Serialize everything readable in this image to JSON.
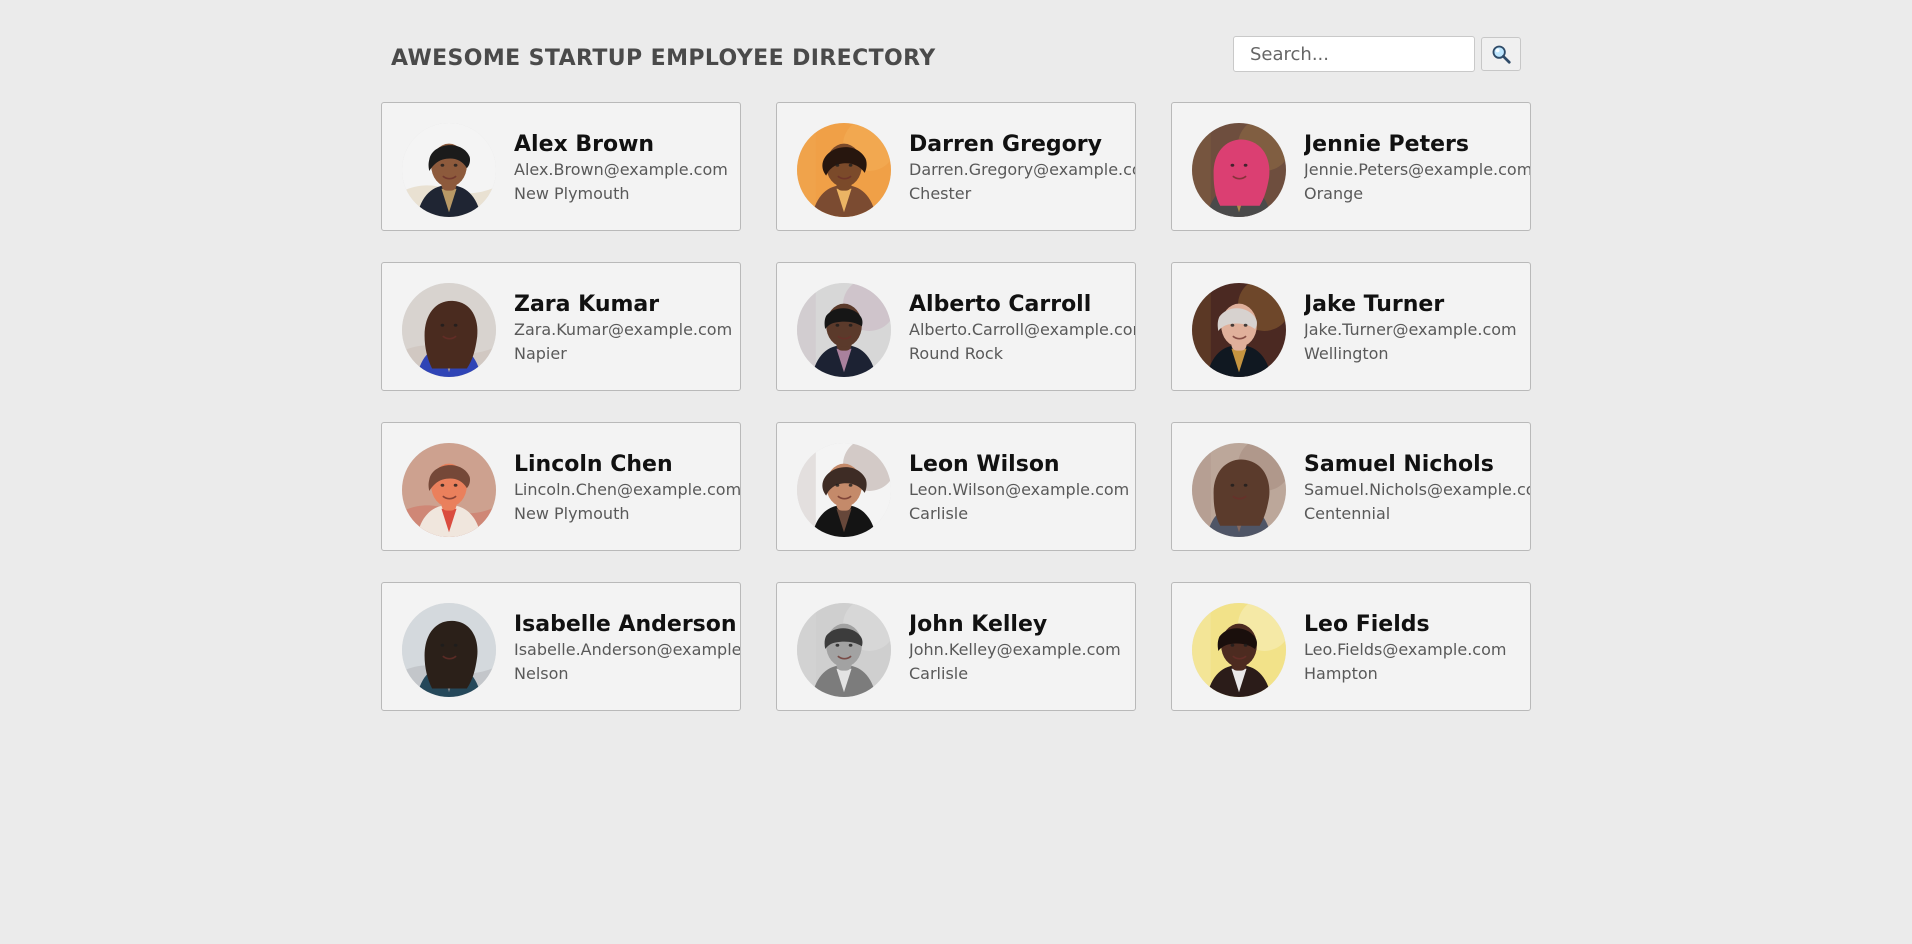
{
  "header": {
    "title": "AWESOME STARTUP EMPLOYEE DIRECTORY",
    "search": {
      "placeholder": "Search...",
      "value": "",
      "button_icon": "magnifier-icon"
    }
  },
  "employees": [
    {
      "name": "Alex Brown",
      "email": "Alex.Brown@example.com",
      "city": "New Plymouth",
      "avatar": {
        "background": "#f4f4f4",
        "skin": "#8d5a3c",
        "hair": "#1b1b1b",
        "shirt": "#1f2533",
        "accent": "#c9a66b"
      }
    },
    {
      "name": "Darren Gregory",
      "email": "Darren.Gregory@example.com",
      "city": "Chester",
      "avatar": {
        "background": "#f0a047",
        "skin": "#7b4a2a",
        "hair": "#27160e",
        "shirt": "#7b4b31",
        "accent": "#f7c06a"
      }
    },
    {
      "name": "Jennie Peters",
      "email": "Jennie.Peters@example.com",
      "city": "Orange",
      "avatar": {
        "background": "#6e4e3e",
        "skin": "#e3a48f",
        "hair": "#db3f72",
        "shirt": "#4a4a4a",
        "accent": "#b78f4d"
      }
    },
    {
      "name": "Zara Kumar",
      "email": "Zara.Kumar@example.com",
      "city": "Napier",
      "avatar": {
        "background": "#d8d3cf",
        "skin": "#d8a48f",
        "hair": "#4a2b1f",
        "shirt": "#2f44b6",
        "accent": "#bba89d"
      }
    },
    {
      "name": "Alberto Carroll",
      "email": "Alberto.Carroll@example.com",
      "city": "Round Rock",
      "avatar": {
        "background": "#d7d7d7",
        "skin": "#5b3a2b",
        "hair": "#161616",
        "shirt": "#1c2233",
        "accent": "#b98ca8"
      }
    },
    {
      "name": "Jake Turner",
      "email": "Jake.Turner@example.com",
      "city": "Wellington",
      "avatar": {
        "background": "#4b2922",
        "skin": "#e0b09b",
        "hair": "#d7d2cf",
        "shirt": "#101821",
        "accent": "#d9a244"
      }
    },
    {
      "name": "Lincoln Chen",
      "email": "Lincoln.Chen@example.com",
      "city": "New Plymouth",
      "avatar": {
        "background": "#cda18f",
        "skin": "#ea805c",
        "hair": "#754838",
        "shirt": "#f0e6dd",
        "accent": "#d73b2d"
      }
    },
    {
      "name": "Leon Wilson",
      "email": "Leon.Wilson@example.com",
      "city": "Carlisle",
      "avatar": {
        "background": "#f4f4f4",
        "skin": "#c48a6a",
        "hair": "#3e2c25",
        "shirt": "#141414",
        "accent": "#6f4d3e"
      }
    },
    {
      "name": "Samuel Nichols",
      "email": "Samuel.Nichols@example.com",
      "city": "Centennial",
      "avatar": {
        "background": "#bca79a",
        "skin": "#d4a18a",
        "hair": "#5b3b2c",
        "shirt": "#4f5566",
        "accent": "#8b6c5f"
      }
    },
    {
      "name": "Isabelle Anderson",
      "email": "Isabelle.Anderson@example.com",
      "city": "Nelson",
      "avatar": {
        "background": "#d4d9dd",
        "skin": "#c99b80",
        "hair": "#2b2019",
        "shirt": "#25485a",
        "accent": "#8e8f93"
      }
    },
    {
      "name": "John Kelley",
      "email": "John.Kelley@example.com",
      "city": "Carlisle",
      "avatar": {
        "background": "#cfcfcf",
        "skin": "#a2a2a2",
        "hair": "#3c3c3c",
        "shirt": "#7c7c7c",
        "accent": "#eeeeee"
      }
    },
    {
      "name": "Leo Fields",
      "email": "Leo.Fields@example.com",
      "city": "Hampton",
      "avatar": {
        "background": "#f2e289",
        "skin": "#4d2b20",
        "hair": "#1a0f0c",
        "shirt": "#2b1c19",
        "accent": "#ffffff"
      }
    }
  ]
}
